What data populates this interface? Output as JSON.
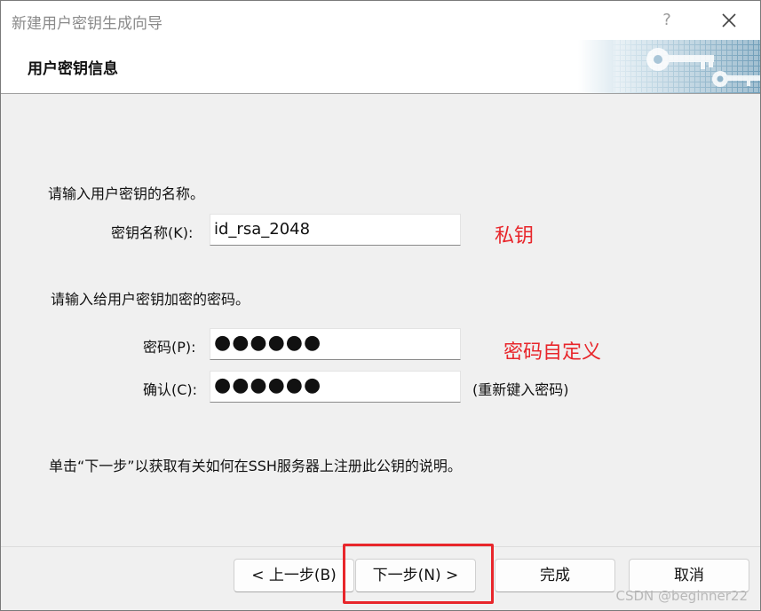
{
  "window": {
    "title": "新建用户密钥生成向导",
    "help_label": "?"
  },
  "header": {
    "title": "用户密钥信息"
  },
  "key_section": {
    "prompt": "请输入用户密钥的名称。",
    "name_label": "密钥名称(K):",
    "name_value": "id_rsa_2048",
    "annotation": "私钥"
  },
  "password_section": {
    "prompt": "请输入给用户密钥加密的密码。",
    "password_label": "密码(P):",
    "password_value": "●●●●●●",
    "confirm_label": "确认(C):",
    "confirm_value": "●●●●●●",
    "confirm_hint": "(重新键入密码)",
    "annotation": "密码自定义"
  },
  "info_text": "单击“下一步”以获取有关如何在SSH服务器上注册此公钥的说明。",
  "buttons": {
    "back": "< 上一步(B)",
    "next": "下一步(N) >",
    "finish": "完成",
    "cancel": "取消"
  },
  "watermark": "CSDN @beginner22",
  "colors": {
    "annotation_red": "#e8262b",
    "header_key_blue": "#6b96b3"
  },
  "icons": {
    "close": "close-icon",
    "header_graphic": "keys-graphic"
  }
}
